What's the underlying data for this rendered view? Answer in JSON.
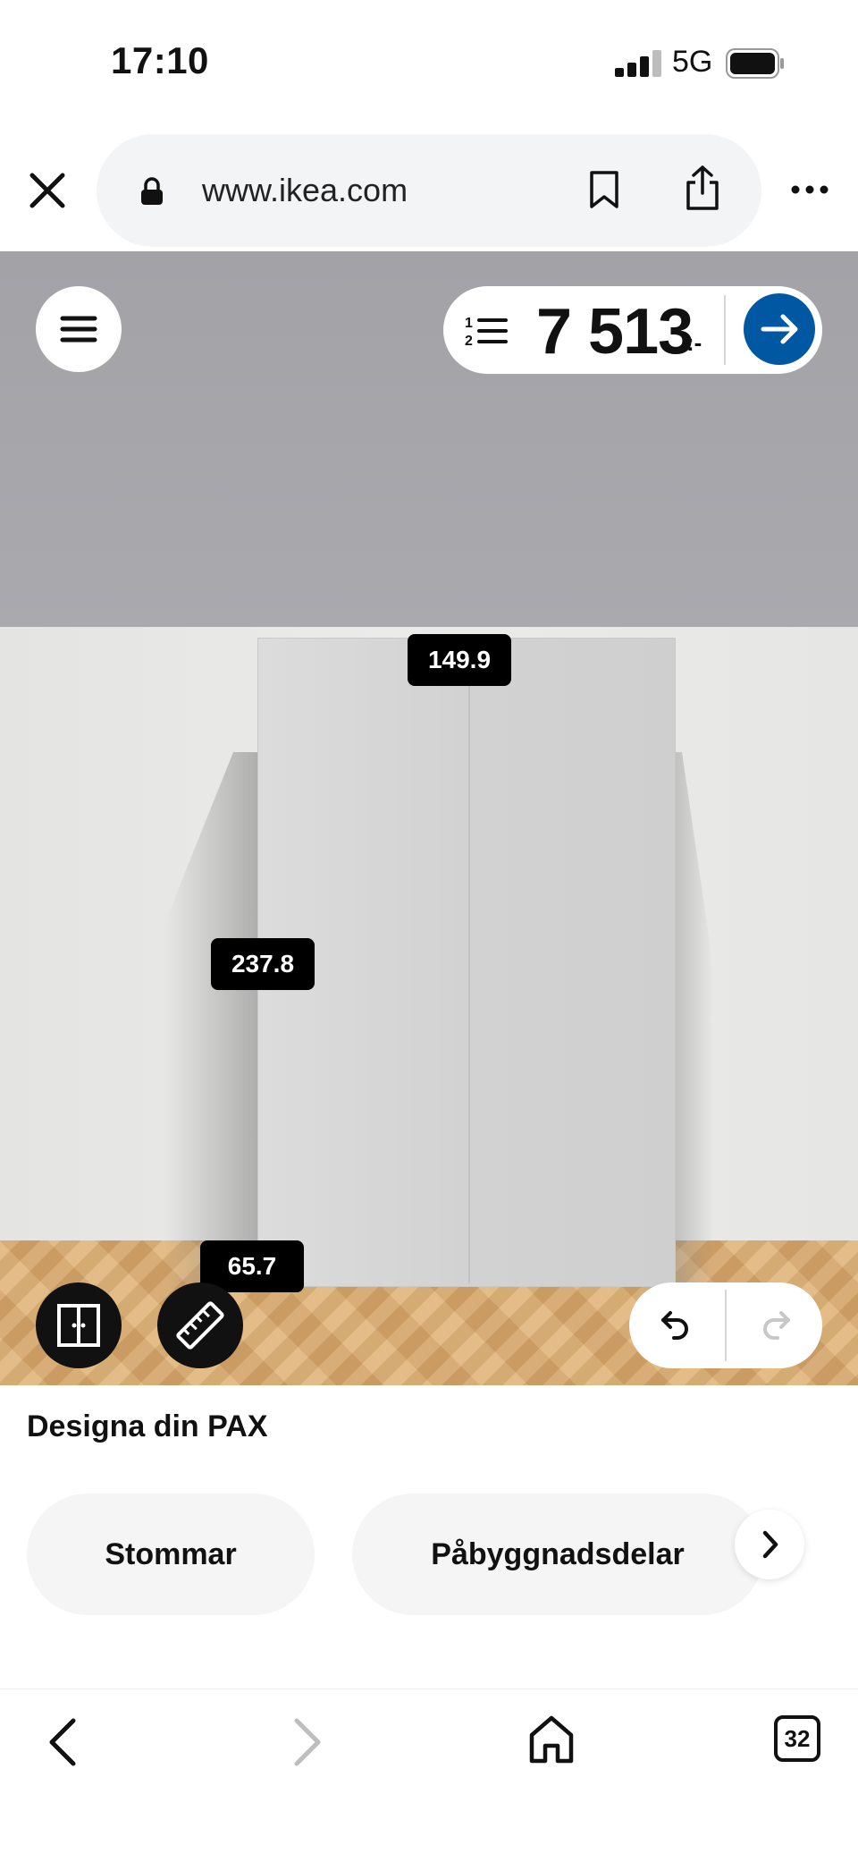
{
  "status_bar": {
    "time": "17:10",
    "network": "5G"
  },
  "browser": {
    "url": "www.ikea.com",
    "tab_count": "32",
    "icons": {
      "close": "close-icon",
      "lock": "lock-icon",
      "bookmark": "bookmark-icon",
      "share": "share-icon",
      "more": "more-icon",
      "back": "back-icon",
      "forward": "forward-icon",
      "home": "home-icon",
      "tabs": "tabs-icon"
    }
  },
  "planner": {
    "price_main": "7 513",
    "price_suffix": ":-",
    "dimensions": {
      "width": "149.9",
      "height": "237.8",
      "depth": "65.7"
    },
    "icons": {
      "menu": "hamburger-menu-icon",
      "list": "numbered-list-icon",
      "checkout": "arrow-right-icon",
      "wardrobe": "wardrobe-doors-icon",
      "measure": "ruler-icon",
      "undo": "undo-icon",
      "redo": "redo-icon"
    },
    "redo_enabled": false
  },
  "panel": {
    "title": "Designa din PAX",
    "chips": [
      "Stommar",
      "Påbyggnadsdelar"
    ]
  },
  "colors": {
    "accent_blue": "#0058a3",
    "dim_label_bg": "#000000"
  }
}
